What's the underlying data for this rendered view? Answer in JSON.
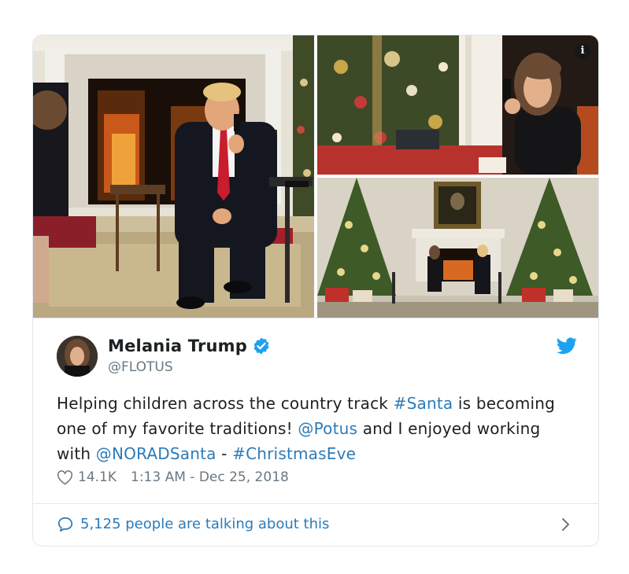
{
  "tweet": {
    "author": {
      "name": "Melania Trump",
      "handle": "@FLOTUS",
      "verified": true
    },
    "text": {
      "part1": "Helping children across the country track ",
      "hashtag1": "#Santa",
      "part2": " is becoming one of my favorite traditions!  ",
      "mention1": "@Potus",
      "part3": " and I enjoyed working with ",
      "mention2": "@NORADSanta",
      "part4": " - ",
      "hashtag2": "#ChristmasEve"
    },
    "likes": "14.1K",
    "timestamp": "1:13 AM - Dec 25, 2018",
    "discussion": "5,125 people are talking about this"
  },
  "icons": {
    "info": "info-icon",
    "verified": "verified-badge-icon",
    "brand": "twitter-bird-icon",
    "like": "heart-icon",
    "reply": "speech-bubble-icon",
    "more": "chevron-right-icon"
  },
  "colors": {
    "link": "#2b7bb9",
    "text": "#1c2022",
    "muted": "#697882",
    "border": "#e1e8ed",
    "verified": "#1da1f2",
    "brand": "#1da1f2"
  }
}
